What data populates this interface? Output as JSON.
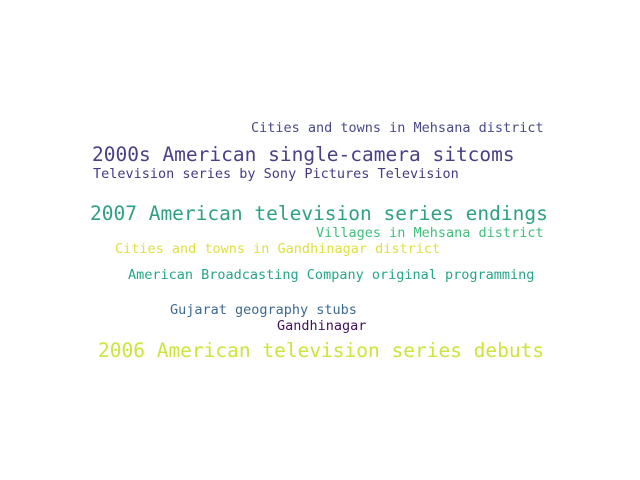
{
  "colors": {
    "background": "#ffffff"
  },
  "words": [
    {
      "text": "Cities and towns in Mehsana district",
      "color": "#4a4a8a"
    },
    {
      "text": "2000s American single-camera sitcoms",
      "color": "#4b3f86"
    },
    {
      "text": "Television series by Sony Pictures Television",
      "color": "#463a84"
    },
    {
      "text": "2007 American television series endings",
      "color": "#2fa086"
    },
    {
      "text": "Villages in Mehsana district",
      "color": "#3fbf7a"
    },
    {
      "text": "Cities and towns in Gandhinagar district",
      "color": "#e0e040"
    },
    {
      "text": "American Broadcasting Company original programming",
      "color": "#25a68a"
    },
    {
      "text": "Gujarat geography stubs",
      "color": "#3b6a92"
    },
    {
      "text": "Gandhinagar",
      "color": "#44105a"
    },
    {
      "text": "2006 American television series debuts",
      "color": "#cde43a"
    }
  ]
}
